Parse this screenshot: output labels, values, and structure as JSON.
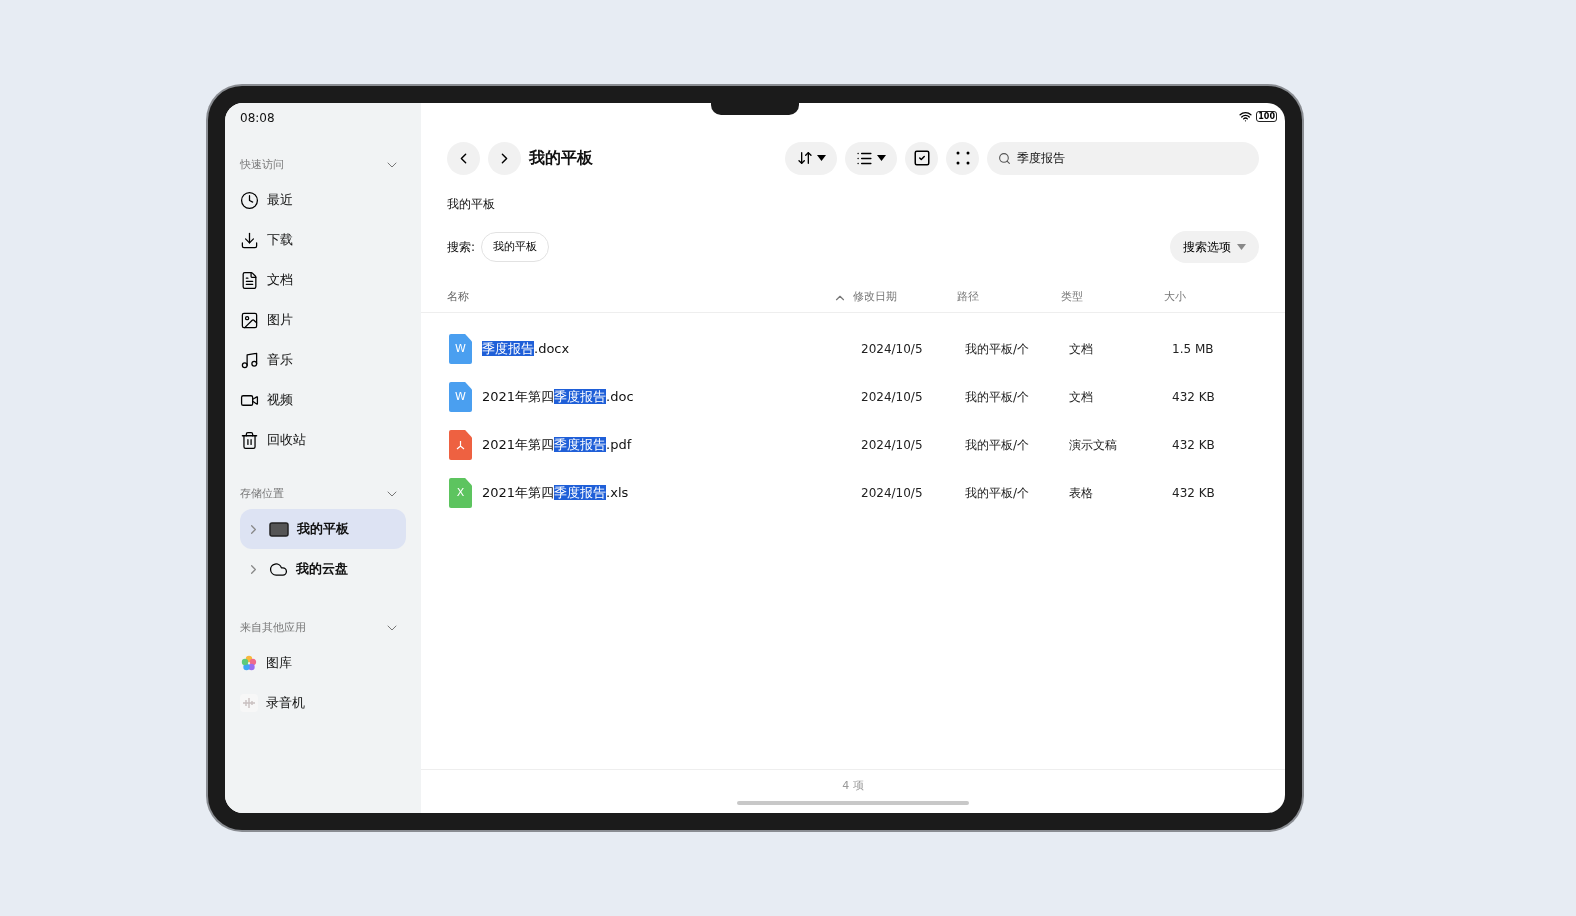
{
  "status_bar": {
    "time": "08:08",
    "battery": "100"
  },
  "sidebar": {
    "sections": [
      {
        "title": "快速访问",
        "expanded": true,
        "items": [
          {
            "label": "最近",
            "kind": "clock",
            "selected": false
          },
          {
            "label": "下载",
            "kind": "download",
            "selected": false
          },
          {
            "label": "文档",
            "kind": "document",
            "selected": false
          },
          {
            "label": "图片",
            "kind": "image",
            "selected": false
          },
          {
            "label": "音乐",
            "kind": "music",
            "selected": false
          },
          {
            "label": "视频",
            "kind": "video",
            "selected": false
          },
          {
            "label": "回收站",
            "kind": "trash",
            "selected": false
          }
        ]
      },
      {
        "title": "存储位置",
        "expanded": true,
        "items": [
          {
            "label": "我的平板",
            "kind": "tablet",
            "selected": true
          },
          {
            "label": "我的云盘",
            "kind": "cloud",
            "selected": false
          }
        ]
      },
      {
        "title": "来自其他应用",
        "expanded": true,
        "items": [
          {
            "label": "图库",
            "kind": "gallery",
            "selected": false
          },
          {
            "label": "录音机",
            "kind": "recorder",
            "selected": false
          }
        ]
      }
    ]
  },
  "toolbar": {
    "title": "我的平板",
    "search": {
      "value": "季度报告"
    }
  },
  "breadcrumb": "我的平板",
  "search_scope": {
    "label": "搜索:",
    "chip": "我的平板",
    "options_button": "搜索选项"
  },
  "table": {
    "columns": [
      {
        "label": "名称",
        "sorted": true
      },
      {
        "label": "修改日期",
        "sorted": false
      },
      {
        "label": "路径",
        "sorted": false
      },
      {
        "label": "类型",
        "sorted": false
      },
      {
        "label": "大小",
        "sorted": false
      }
    ],
    "rows": [
      {
        "kind": "word",
        "icon_letter": "W",
        "name_parts": [
          {
            "text": "季度报告",
            "highlighted": true
          },
          {
            "text": ".docx",
            "highlighted": false
          }
        ],
        "date": "2024/10/5",
        "path": "我的平板/个",
        "type": "文档",
        "size": "1.5 MB"
      },
      {
        "kind": "word",
        "icon_letter": "W",
        "name_parts": [
          {
            "text": "2021年第四",
            "highlighted": false
          },
          {
            "text": "季度报告",
            "highlighted": true
          },
          {
            "text": ".doc",
            "highlighted": false
          }
        ],
        "date": "2024/10/5",
        "path": "我的平板/个",
        "type": "文档",
        "size": "432 KB"
      },
      {
        "kind": "pdf",
        "name_parts": [
          {
            "text": "2021年第四",
            "highlighted": false
          },
          {
            "text": "季度报告",
            "highlighted": true
          },
          {
            "text": ".pdf",
            "highlighted": false
          }
        ],
        "date": "2024/10/5",
        "path": "我的平板/个",
        "type": "演示文稿",
        "size": "432 KB"
      },
      {
        "kind": "excel",
        "icon_letter": "X",
        "name_parts": [
          {
            "text": "2021年第四",
            "highlighted": false
          },
          {
            "text": "季度报告",
            "highlighted": true
          },
          {
            "text": ".xls",
            "highlighted": false
          }
        ],
        "date": "2024/10/5",
        "path": "我的平板/个",
        "type": "表格",
        "size": "432 KB"
      }
    ]
  },
  "footer": {
    "count": "4 项"
  }
}
